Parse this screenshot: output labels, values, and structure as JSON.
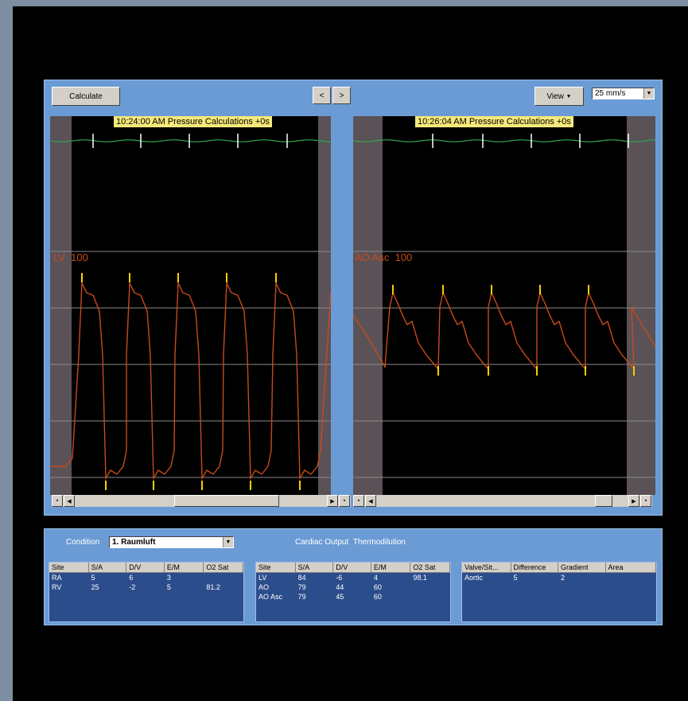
{
  "toolbar": {
    "calculate_label": "Calculate",
    "prev_label": "<",
    "next_label": ">",
    "view_label": "View",
    "speed_value": "25 mm/s"
  },
  "left_panel": {
    "timestamp": "10:24:00 AM Pressure Calculations +0s",
    "channel": "LV",
    "scale": "100"
  },
  "right_panel": {
    "timestamp": "10:26:04 AM Pressure Calculations +0s",
    "channel": "AO Asc",
    "scale": "100"
  },
  "bottom": {
    "condition_label": "Condition",
    "condition_value": "1. Raumluft",
    "cardiac_output_label": "Cardiac Output",
    "thermodilution_label": "Thermodilution"
  },
  "table1": {
    "headers": [
      "Site",
      "S/A",
      "D/V",
      "E/M",
      "O2 Sat"
    ],
    "rows": [
      [
        "RA",
        "5",
        "6",
        "3",
        ""
      ],
      [
        "RV",
        "25",
        "-2",
        "5",
        "81.2"
      ]
    ]
  },
  "table2": {
    "headers": [
      "Site",
      "S/A",
      "D/V",
      "E/M",
      "O2 Sat"
    ],
    "rows": [
      [
        "LV",
        "84",
        "-6",
        "4",
        "98.1"
      ],
      [
        "AO",
        "79",
        "44",
        "60",
        ""
      ],
      [
        "AO Asc",
        "79",
        "45",
        "60",
        ""
      ]
    ]
  },
  "table3": {
    "headers": [
      "Valve/Sit...",
      "Difference",
      "Gradient",
      "Area"
    ],
    "rows": [
      [
        "Aortic",
        "5",
        "2",
        ""
      ]
    ]
  },
  "colors": {
    "panel_blue": "#6b9bd5",
    "ecg_green": "#2fa84f",
    "pressure_orange": "#c84a1a",
    "marker_yellow": "#f5d000"
  }
}
